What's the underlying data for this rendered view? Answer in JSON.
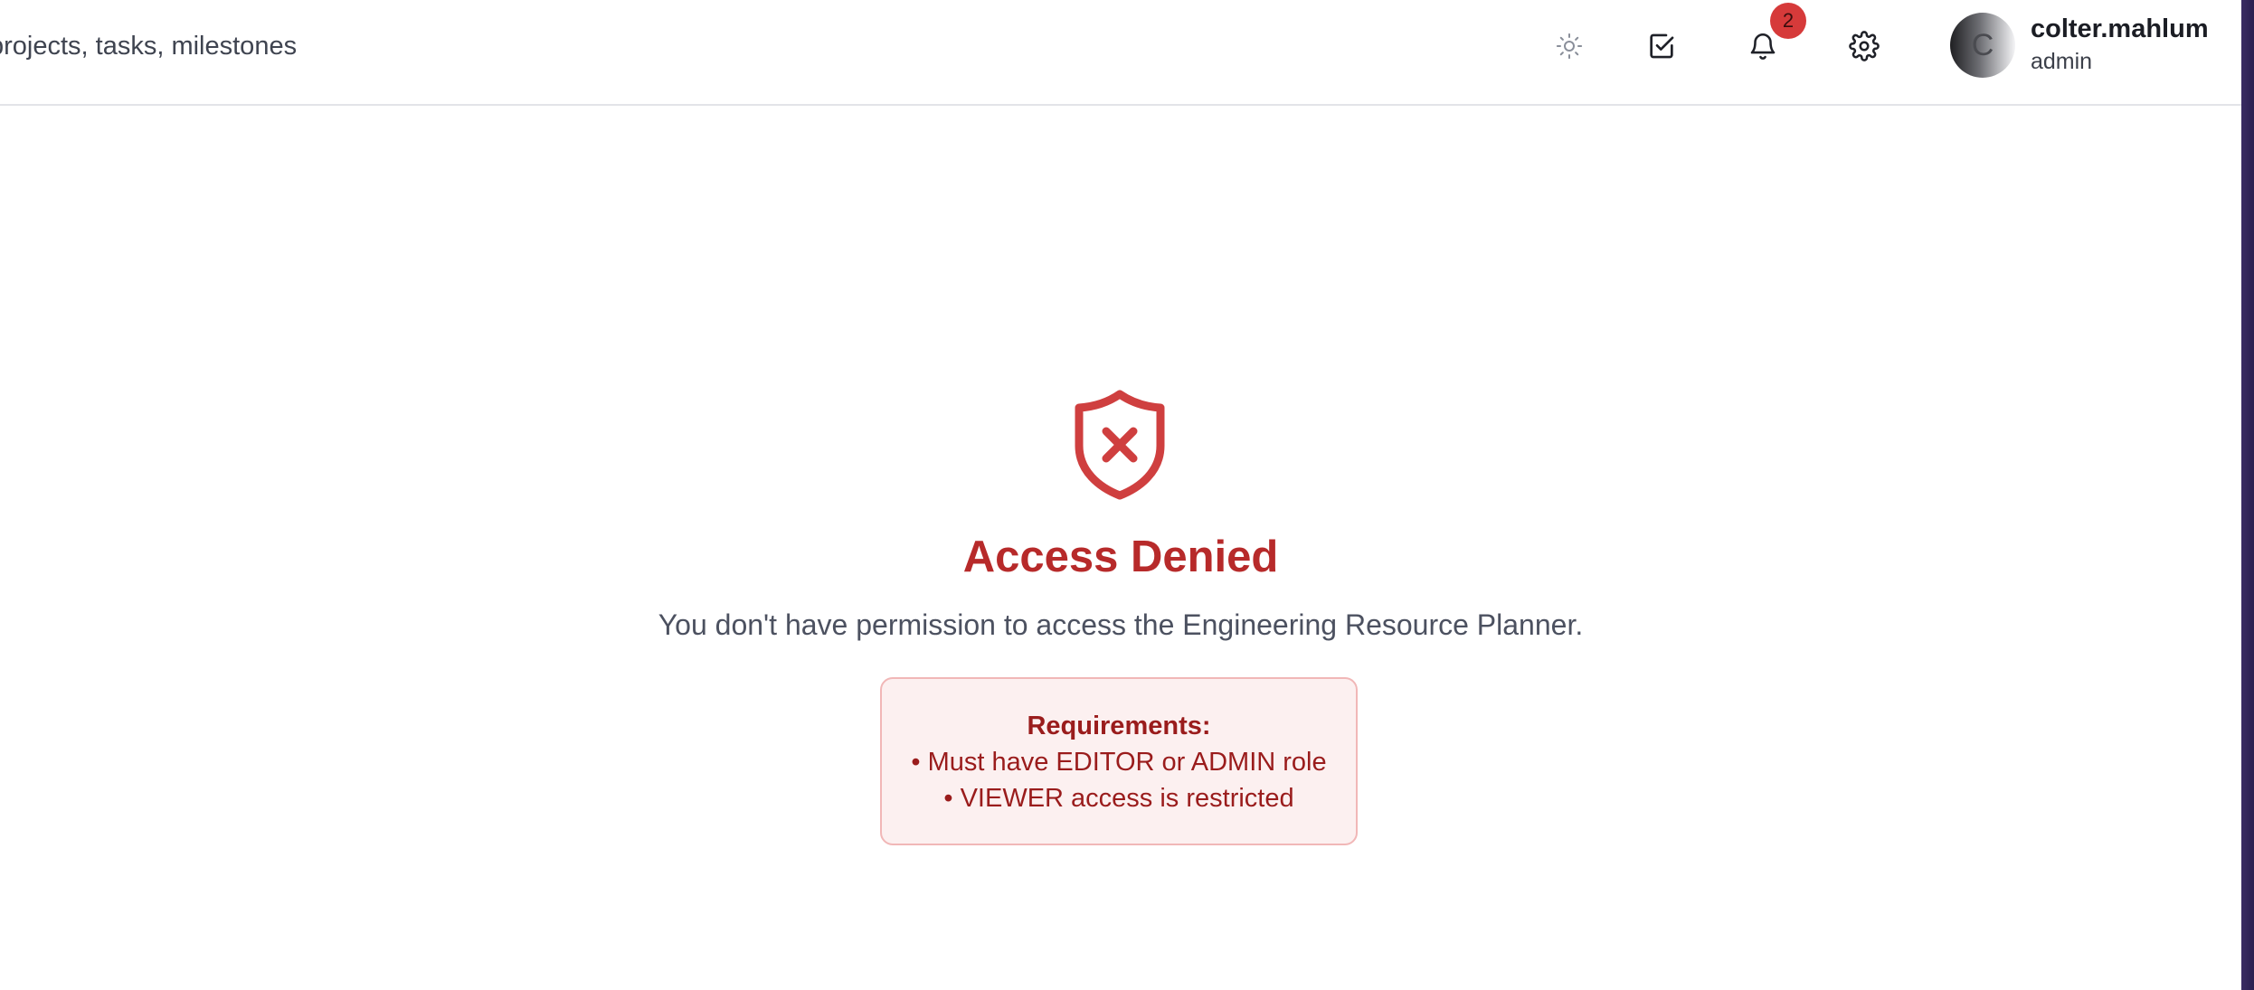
{
  "header": {
    "search": {
      "placeholder": "projects, tasks, milestones",
      "icon": "search-icon"
    },
    "actions": [
      {
        "name": "theme-toggle",
        "icon": "sun-icon"
      },
      {
        "name": "tasks",
        "icon": "check-square-icon"
      },
      {
        "name": "notifications",
        "icon": "bell-icon",
        "badge": "2"
      },
      {
        "name": "settings",
        "icon": "gear-icon"
      }
    ],
    "user": {
      "initial": "C",
      "name": "colter.mahlum",
      "role": "admin"
    }
  },
  "main": {
    "icon": "shield-x-icon",
    "title": "Access Denied",
    "message": "You don't have permission to access the Engineering Resource Planner.",
    "requirements": {
      "title": "Requirements:",
      "items": [
        "• Must have EDITOR or ADMIN role",
        "• VIEWER access is restricted"
      ]
    }
  },
  "colors": {
    "danger": "#b72a2a",
    "danger_text": "#9a1c1c",
    "danger_bg": "#fcf0f0",
    "danger_border": "#f1b7b7",
    "badge": "#d63a3a",
    "sidebar_edge": "#2a1f4f"
  }
}
